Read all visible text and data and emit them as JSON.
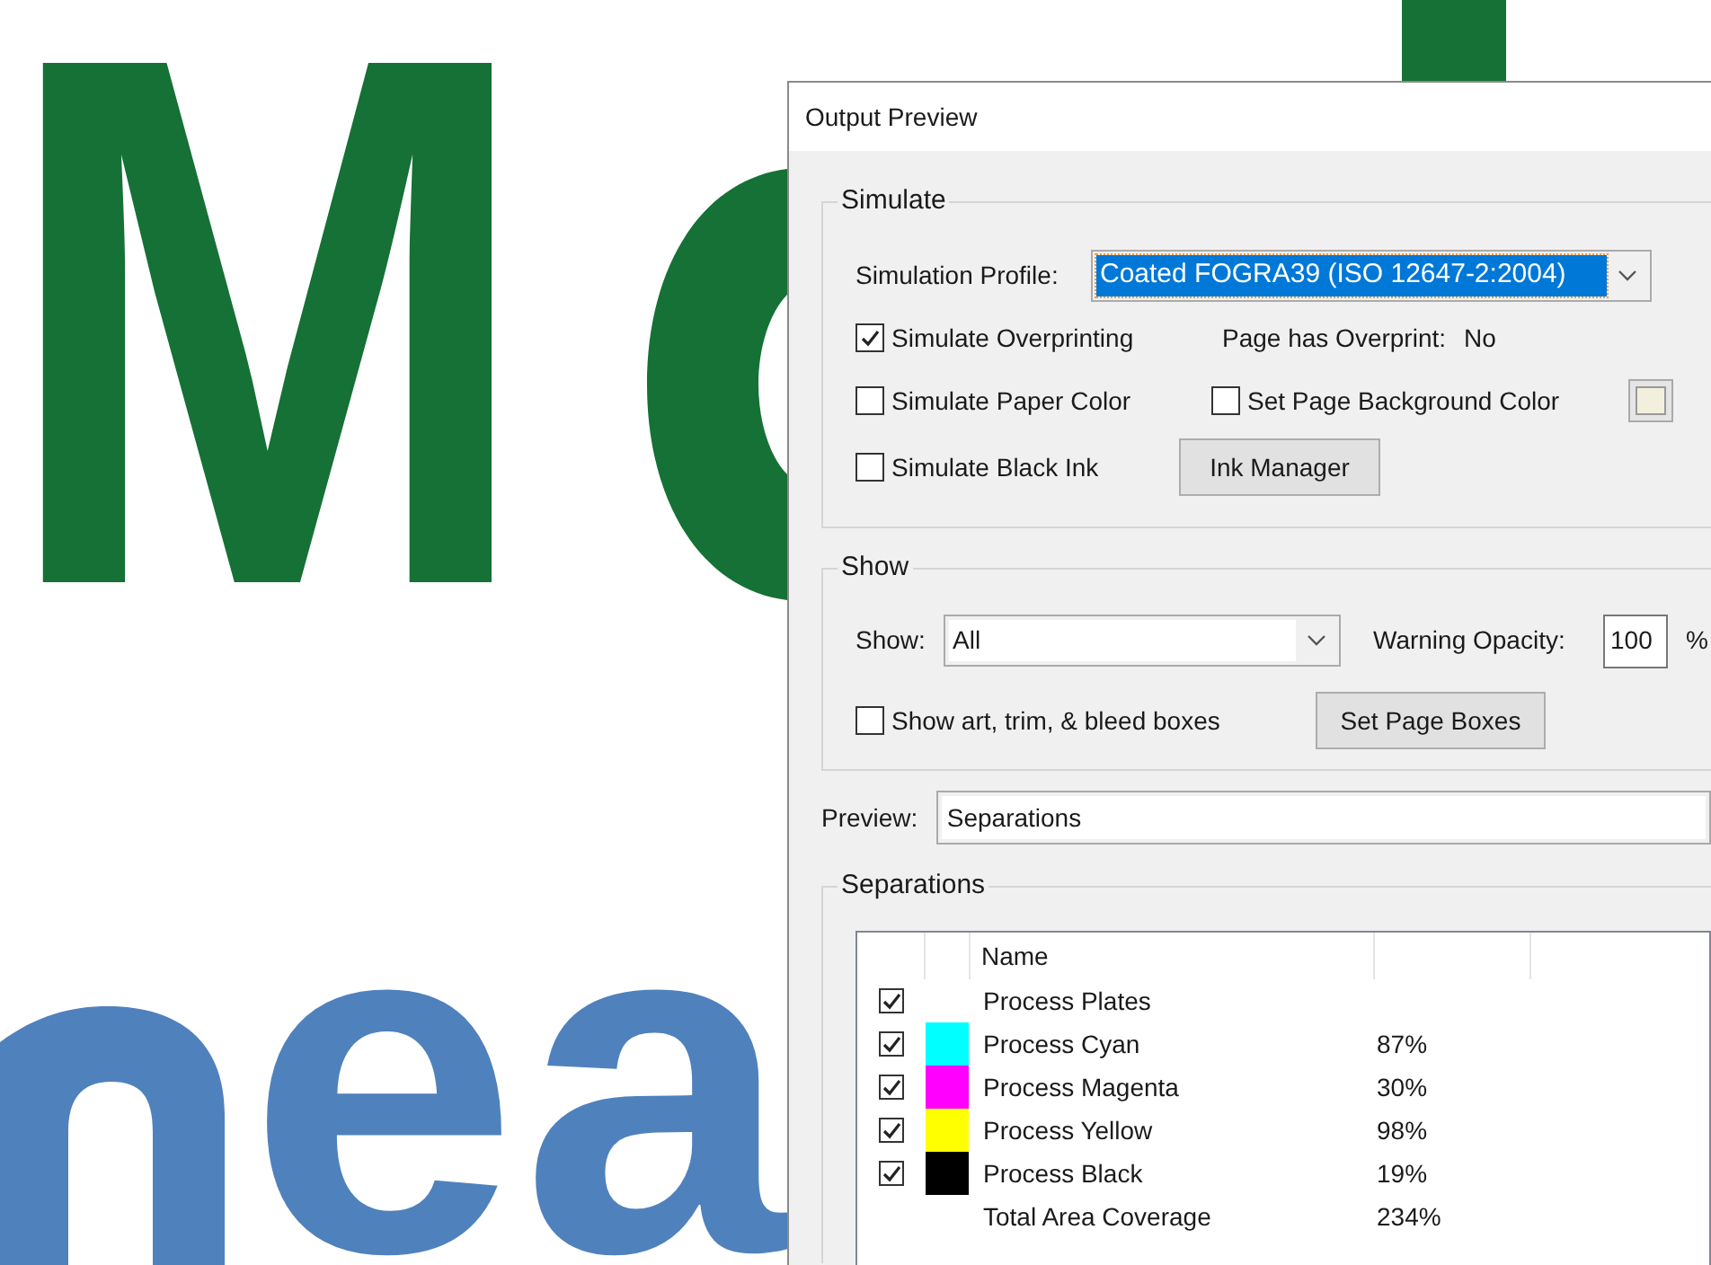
{
  "document": {
    "heading": "M",
    "line_2": "ea"
  },
  "dialog": {
    "title": "Output Preview",
    "simulate": {
      "title": "Simulate",
      "profile_label": "Simulation Profile:",
      "profile_value": "Coated FOGRA39 (ISO 12647-2:2004)",
      "profile_focused": true,
      "overprinting": {
        "label": "Simulate Overprinting",
        "checked": true
      },
      "overprint_status": {
        "label": "Page has Overprint:",
        "value": "No"
      },
      "paper_color": {
        "label": "Simulate Paper Color",
        "checked": false
      },
      "page_background": {
        "label": "Set Page Background Color",
        "checked": false
      },
      "black_ink": {
        "label": "Simulate Black Ink",
        "checked": false
      },
      "ink_manager_button": "Ink Manager"
    },
    "show": {
      "title": "Show",
      "show_label": "Show:",
      "show_value": "All",
      "opacity_label": "Warning Opacity:",
      "opacity_value": "100",
      "opacity_unit": "%",
      "boxes": {
        "label": "Show art, trim, & bleed boxes",
        "checked": false
      },
      "page_boxes_button": "Set Page Boxes"
    },
    "preview": {
      "label": "Preview:",
      "value": "Separations"
    },
    "separations": {
      "title": "Separations",
      "name_column": "Name",
      "rows": [
        {
          "kind": "plates",
          "name": "Process Plates",
          "checked": true
        },
        {
          "kind": "ink",
          "name": "Process Cyan",
          "checked": true,
          "color": "#00ffff",
          "coverage": "87%"
        },
        {
          "kind": "ink",
          "name": "Process Magenta",
          "checked": true,
          "color": "#ff00ff",
          "coverage": "30%"
        },
        {
          "kind": "ink",
          "name": "Process Yellow",
          "checked": true,
          "color": "#ffff00",
          "coverage": "98%"
        },
        {
          "kind": "ink",
          "name": "Process Black",
          "checked": true,
          "color": "#000000",
          "coverage": "19%"
        },
        {
          "kind": "total",
          "name": "Total Area Coverage",
          "coverage": "234%"
        }
      ]
    }
  }
}
